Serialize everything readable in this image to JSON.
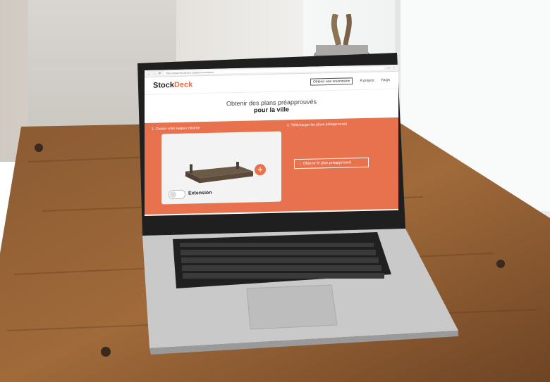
{
  "browser": {
    "url": "https://www.StockDeck.ca/plans-municipaux"
  },
  "nav": {
    "logo_part1": "Stock",
    "logo_part2": "Deck",
    "cta": "Obtenir une soumission",
    "link_about": "À propos",
    "link_faq": "FAQs"
  },
  "hero": {
    "line1": "Obtenir des plans préapprouvés",
    "line2": "pour la ville"
  },
  "panel": {
    "step1": "1. Choisir votre largeur désirée",
    "step2": "2. Télécharger les plans préapprouvés",
    "toggle_label": "Extension",
    "download_button": "Obtenir le plan préapprouvé"
  },
  "colors": {
    "accent": "#e8714e"
  }
}
